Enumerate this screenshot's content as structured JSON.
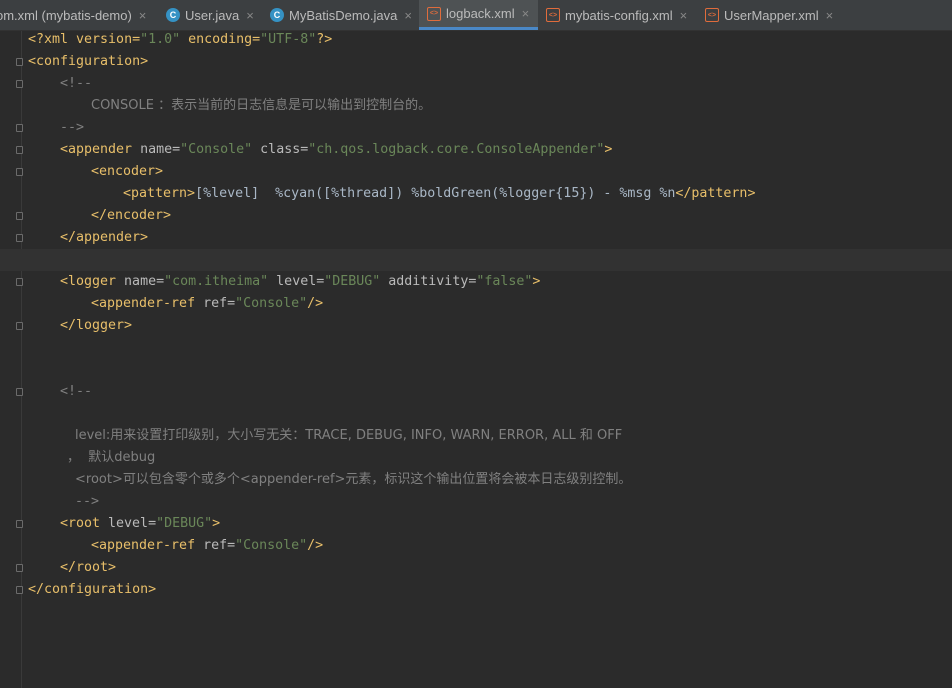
{
  "tabs": [
    {
      "label": "om.xml (mybatis-demo)",
      "icon": "none"
    },
    {
      "label": "User.java",
      "icon": "class-icon"
    },
    {
      "label": "MyBatisDemo.java",
      "icon": "runnable-class-icon"
    },
    {
      "label": "logback.xml",
      "icon": "xml-file-icon",
      "active": true
    },
    {
      "label": "mybatis-config.xml",
      "icon": "xml-file-icon"
    },
    {
      "label": "UserMapper.xml",
      "icon": "xml-file-icon"
    }
  ],
  "close_glyph": "×",
  "code": {
    "l1": {
      "a": "<?xml version=",
      "b": "\"1.0\"",
      "c": " encoding=",
      "d": "\"UTF-8\"",
      "e": "?>"
    },
    "l2": "<configuration>",
    "l3": "<!--",
    "l4": "CONSOLE ：表示当前的日志信息是可以输出到控制台的。",
    "l5": "-->",
    "l6": {
      "tag": "<appender",
      "a1": " name=",
      "v1": "\"Console\"",
      "a2": " class=",
      "v2": "\"ch.qos.logback.core.ConsoleAppender\"",
      "end": ">"
    },
    "l7": "<encoder>",
    "l8": {
      "open": "<pattern>",
      "body": "[%level]  %cyan([%thread]) %boldGreen(%logger{15}) - %msg %n",
      "close": "</pattern>"
    },
    "l9": "</encoder>",
    "l10": "</appender>",
    "l12": {
      "tag": "<logger",
      "a1": " name=",
      "v1": "\"com.itheima\"",
      "a2": " level=",
      "v2": "\"DEBUG\"",
      "a3": " additivity=",
      "v3": "\"false\"",
      "end": ">"
    },
    "l13": {
      "tag": "<appender-ref",
      "a1": " ref=",
      "v1": "\"Console\"",
      "end": "/>"
    },
    "l14": "</logger>",
    "l17": "<!--",
    "l19": "level:用来设置打印级别，大小写无关：TRACE, DEBUG, INFO, WARN, ERROR, ALL 和 OFF",
    "l20": "，  默认debug",
    "l21": "<root>可以包含零个或多个<appender-ref>元素，标识这个输出位置将会被本日志级别控制。",
    "l22": "-->",
    "l23": {
      "tag": "<root",
      "a1": " level=",
      "v1": "\"DEBUG\"",
      "end": ">"
    },
    "l24": {
      "tag": "<appender-ref",
      "a1": " ref=",
      "v1": "\"Console\"",
      "end": "/>"
    },
    "l25": "</root>",
    "l26": "</configuration>"
  },
  "colors": {
    "background": "#2b2b2b",
    "tag": "#e8bf6a",
    "attribute": "#bababa",
    "value": "#6a8759",
    "comment": "#808080",
    "text": "#a9b7c6",
    "active_tab_underline": "#4a88c7"
  }
}
